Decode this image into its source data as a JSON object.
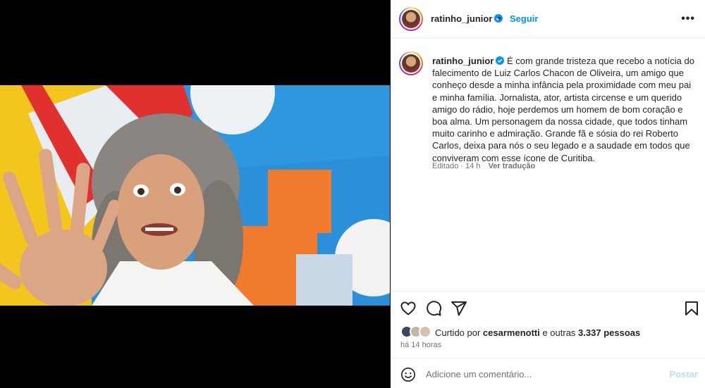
{
  "post": {
    "username": "ratinho_junior",
    "follow_label": "Seguir",
    "separator": "•",
    "more_label": "•••",
    "caption": "É com grande tristeza que recebo a notícia do falecimento de Luiz Carlos Chacon de Oliveira, um amigo que conheço desde a minha infância pela proximidade com meu pai e minha família. Jornalista, ator, artista circense e um querido amigo do rádio, hoje perdemos um homem de bom coração e boa alma. Um personagem da nossa cidade, que todos tinham muito carinho e admiração. Grande fã e sósia do rei Roberto Carlos, deixa para nós o seu legado e a saudade em todos que conviveram com esse ícone de Curitiba.",
    "edited_label": "Editado · 14 h",
    "translate_label": "Ver tradução"
  },
  "likes": {
    "prefix": "Curtido por ",
    "user": "cesarmenotti",
    "suffix": " e outras ",
    "count": "3.337 pessoas"
  },
  "time_ago": "há 14 horas",
  "comment": {
    "placeholder": "Adicione um comentário...",
    "post_label": "Postar"
  },
  "colors": {
    "link": "#0095f6",
    "post_disabled": "#b2dffc",
    "verified": "#0095f6"
  },
  "icons": [
    "heart-icon",
    "comment-icon",
    "share-icon",
    "bookmark-icon",
    "emoji-icon",
    "verified-icon",
    "more-icon"
  ]
}
